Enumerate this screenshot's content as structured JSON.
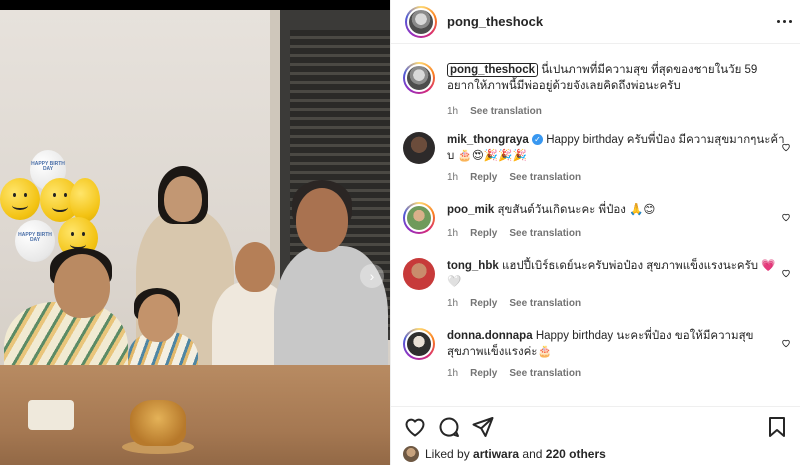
{
  "post": {
    "author": "pong_theshock",
    "avatar_icon": "profile-avatar-icon"
  },
  "photo": {
    "balloon_text": "HAPPY BIRTH DAY"
  },
  "caption": {
    "username": "pong_theshock",
    "text": "นี่เปนภาพที่มีความสุข ที่สุดของชายในวัย 59 อยากให้ภาพนี้มีพ่ออยู่ด้วยจังเลยคิดถึงพ่อนะครับ",
    "time": "1h",
    "see_translation": "See translation"
  },
  "comments": [
    {
      "username": "mik_thongraya",
      "verified": true,
      "text": "Happy birthday ครับพี่ป๋อง มีความสุขมากๆนะค้าบ 🎂😍🎉🎉🎉",
      "time": "1h",
      "reply": "Reply",
      "see_translation": "See translation"
    },
    {
      "username": "poo_mik",
      "verified": false,
      "text": "สุขสันต์วันเกิดนะคะ พี่ป๋อง 🙏😊",
      "time": "1h",
      "reply": "Reply",
      "see_translation": "See translation"
    },
    {
      "username": "tong_hbk",
      "verified": false,
      "text": "แฮปปี้เบิร์ธเดย์นะครับพ่อป๋อง สุขภาพแข็งแรงนะครับ 💗🤍",
      "time": "1h",
      "reply": "Reply",
      "see_translation": "See translation"
    },
    {
      "username": "donna.donnapa",
      "verified": false,
      "text": "Happy birthday นะคะพี่ป๋อง ขอให้มีความสุข สุขภาพแข็งแรงค่ะ🎂",
      "time": "1h",
      "reply": "Reply",
      "see_translation": "See translation"
    }
  ],
  "likes": {
    "prefix": "Liked by",
    "user": "artiwara",
    "joiner": "and",
    "others": "220 others"
  },
  "colors": {
    "text": "#262626",
    "muted": "#737373",
    "verified": "#3897f0",
    "story_ring": "#d62976"
  }
}
